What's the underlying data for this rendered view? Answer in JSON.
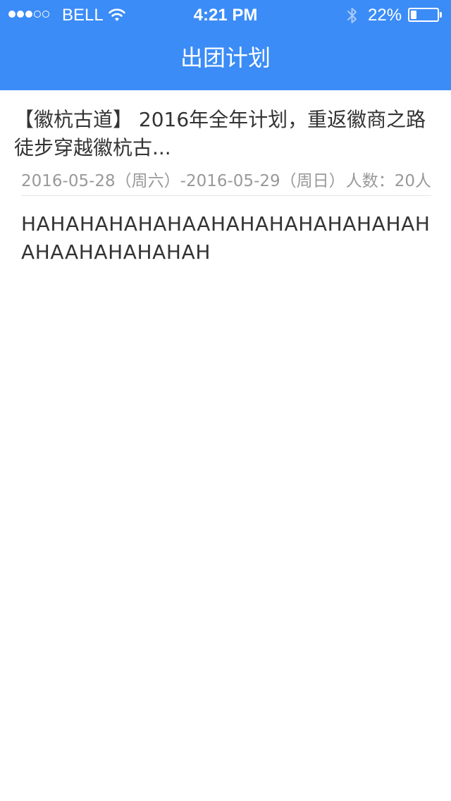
{
  "status_bar": {
    "carrier": "BELL",
    "time": "4:21 PM",
    "battery_percent": "22%",
    "battery_level": 0.22,
    "signal_bars_filled": 3,
    "signal_bars_total": 5
  },
  "header": {
    "title": "出团计划",
    "background_color": "#3b8cf7"
  },
  "plan": {
    "title": "【徽杭古道】 2016年全年计划，重返徽商之路徒步穿越徽杭古...",
    "dates": "2016-05-28（周六）-2016-05-29（周日）",
    "people_label": "人数：",
    "people_value": "20人"
  },
  "description": "HAHAHAHAHAHAAHAHAHAHAHAHAHAHAHAAHAHAHAHAH"
}
